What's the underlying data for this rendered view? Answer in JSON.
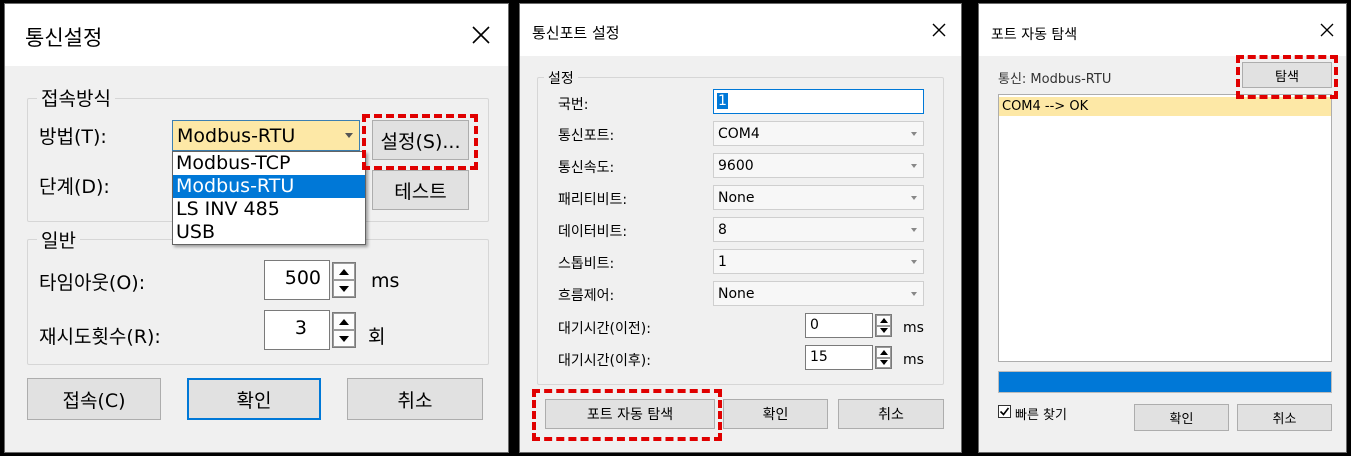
{
  "dialog1": {
    "title": "통신설정",
    "group_connect": "접속방식",
    "method_label": "방법(T):",
    "method_value": "Modbus-RTU",
    "method_options": [
      "Modbus-TCP",
      "Modbus-RTU",
      "LS INV 485",
      "USB"
    ],
    "stage_label": "단계(D):",
    "settings_button": "설정(S)...",
    "test_button": "테스트",
    "group_general": "일반",
    "timeout_label": "타임아웃(O):",
    "timeout_value": "500",
    "timeout_unit": "ms",
    "retry_label": "재시도횟수(R):",
    "retry_value": "3",
    "retry_unit": "회",
    "connect_button": "접속(C)",
    "ok_button": "확인",
    "cancel_button": "취소"
  },
  "dialog2": {
    "title": "통신포트 설정",
    "group_settings": "설정",
    "station_label": "국번:",
    "station_value": "1",
    "port_label": "통신포트:",
    "port_value": "COM4",
    "baud_label": "통신속도:",
    "baud_value": "9600",
    "parity_label": "패리티비트:",
    "parity_value": "None",
    "data_label": "데이터비트:",
    "data_value": "8",
    "stop_label": "스톱비트:",
    "stop_value": "1",
    "flow_label": "흐름제어:",
    "flow_value": "None",
    "wait_before_label": "대기시간(이전):",
    "wait_before_value": "0",
    "wait_after_label": "대기시간(이후):",
    "wait_after_value": "15",
    "wait_unit": "ms",
    "auto_search_button": "포트 자동 탐색",
    "ok_button": "확인",
    "cancel_button": "취소"
  },
  "dialog3": {
    "title": "포트 자동 탐색",
    "comm_label": "통신: Modbus-RTU",
    "search_button": "탐색",
    "result_item": "COM4 --> OK",
    "progress": 1.0,
    "fast_search_label": "빠른 찾기",
    "fast_search_checked": true,
    "ok_button": "확인",
    "cancel_button": "취소"
  },
  "colors": {
    "highlight_red": "#e00000",
    "selection_blue": "#0078d7",
    "result_row": "#fde8a6"
  }
}
